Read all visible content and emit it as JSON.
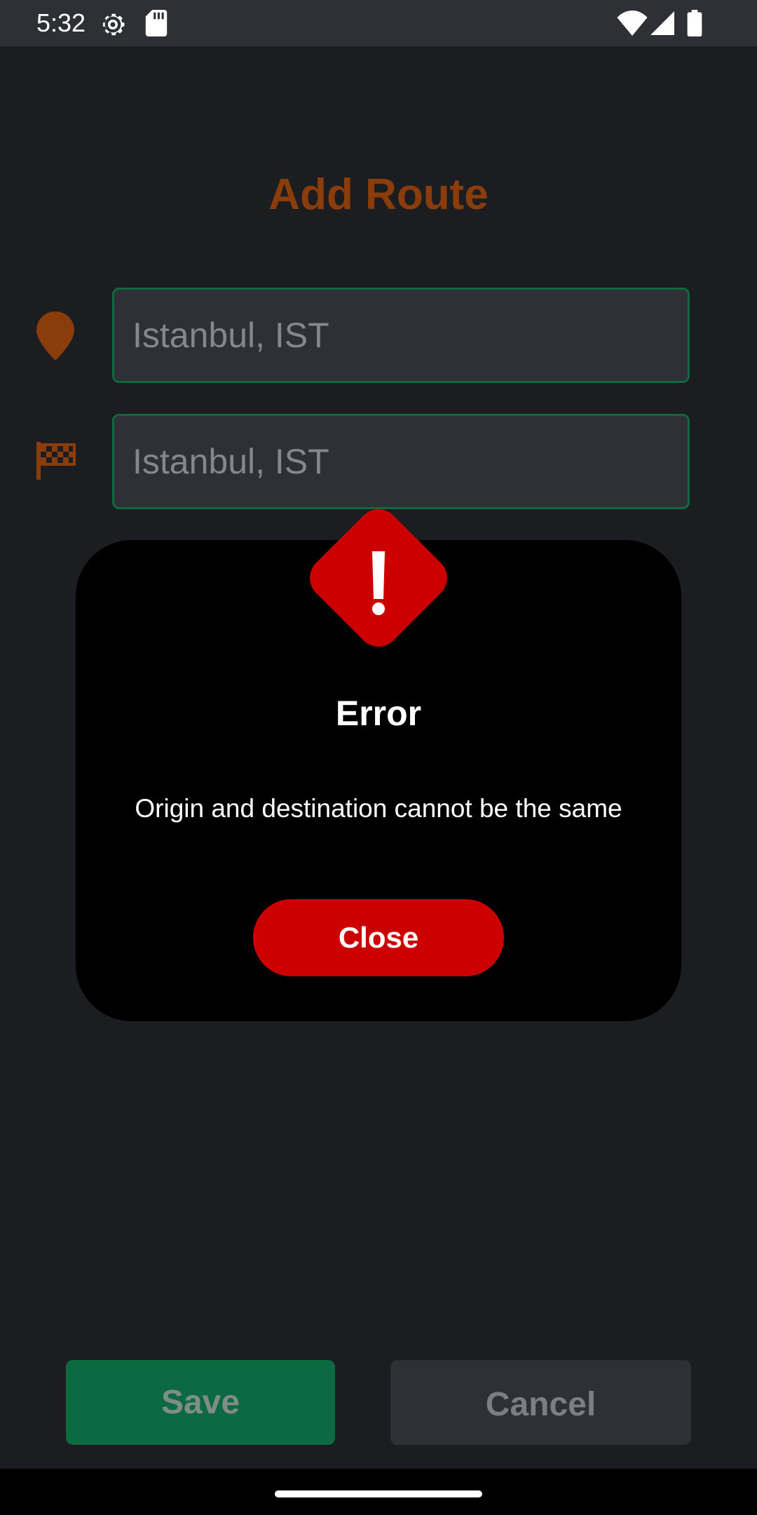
{
  "status_bar": {
    "time": "5:32",
    "icons": [
      "settings-gear-icon",
      "sd-card-icon",
      "wifi-icon",
      "cell-signal-icon",
      "battery-icon"
    ]
  },
  "page": {
    "title": "Add Route",
    "origin_field": {
      "placeholder": "Istanbul, IST",
      "icon": "map-pin-icon"
    },
    "destination_field": {
      "placeholder": "Istanbul, IST",
      "icon": "checkered-flag-icon"
    },
    "save_label": "Save",
    "cancel_label": "Cancel"
  },
  "dialog": {
    "icon": "error-exclamation-icon",
    "title": "Error",
    "message": "Origin and destination cannot be the same",
    "close_label": "Close"
  },
  "colors": {
    "background": "#1c1d21",
    "accent_orange": "#8a3d0b",
    "field_border": "#10683f",
    "save_green": "#0c6a42",
    "error_red": "#cc0000"
  }
}
